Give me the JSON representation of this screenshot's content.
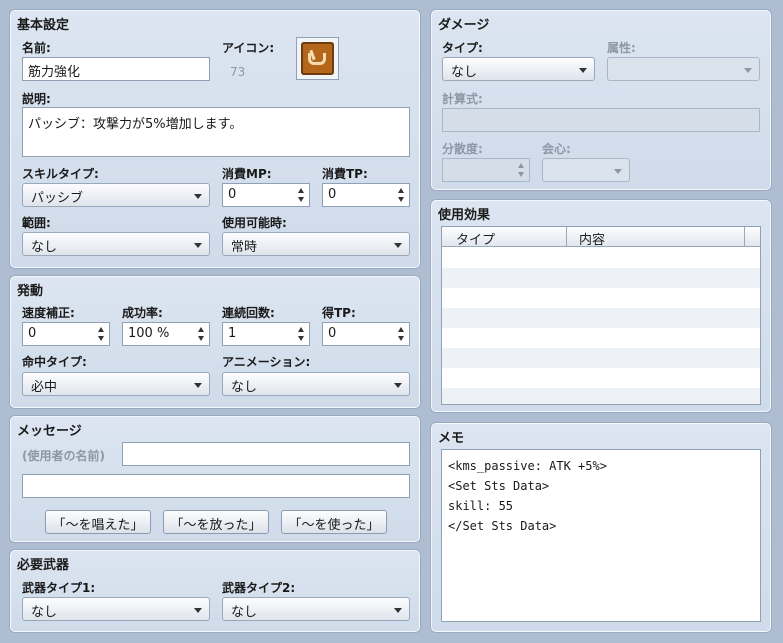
{
  "basic": {
    "title": "基本設定",
    "name_label": "名前:",
    "name_value": "筋力強化",
    "icon_label": "アイコン:",
    "icon_index": "73",
    "icon_name": "boot-icon",
    "desc_label": "説明:",
    "desc_value": "パッシブ：攻撃力が5%増加します。",
    "skilltype_label": "スキルタイプ:",
    "skilltype_value": "パッシブ",
    "mp_label": "消費MP:",
    "mp_value": "0",
    "tp_label": "消費TP:",
    "tp_value": "0",
    "scope_label": "範囲:",
    "scope_value": "なし",
    "occasion_label": "使用可能時:",
    "occasion_value": "常時"
  },
  "invocation": {
    "title": "発動",
    "speed_label": "速度補正:",
    "speed_value": "0",
    "success_label": "成功率:",
    "success_value": "100 %",
    "repeats_label": "連続回数:",
    "repeats_value": "1",
    "tpgain_label": "得TP:",
    "tpgain_value": "0",
    "hittype_label": "命中タイプ:",
    "hittype_value": "必中",
    "animation_label": "アニメーション:",
    "animation_value": "なし"
  },
  "message": {
    "title": "メッセージ",
    "user_name_label": "(使用者の名前)",
    "line1_value": "",
    "line2_value": "",
    "btn_cast": "「〜を唱えた」",
    "btn_release": "「〜を放った」",
    "btn_use": "「〜を使った」"
  },
  "weapons": {
    "title": "必要武器",
    "type1_label": "武器タイプ1:",
    "type1_value": "なし",
    "type2_label": "武器タイプ2:",
    "type2_value": "なし"
  },
  "damage": {
    "title": "ダメージ",
    "type_label": "タイプ:",
    "type_value": "なし",
    "element_label": "属性:",
    "element_value": "",
    "formula_label": "計算式:",
    "formula_value": "",
    "variance_label": "分散度:",
    "variance_value": "",
    "critical_label": "会心:",
    "critical_value": ""
  },
  "effects": {
    "title": "使用効果",
    "col_type": "タイプ",
    "col_content": "内容"
  },
  "memo": {
    "title": "メモ",
    "lines": [
      "<kms_passive: ATK +5%>",
      "<Set Sts Data>",
      "skill: 55",
      "</Set Sts Data>"
    ]
  }
}
